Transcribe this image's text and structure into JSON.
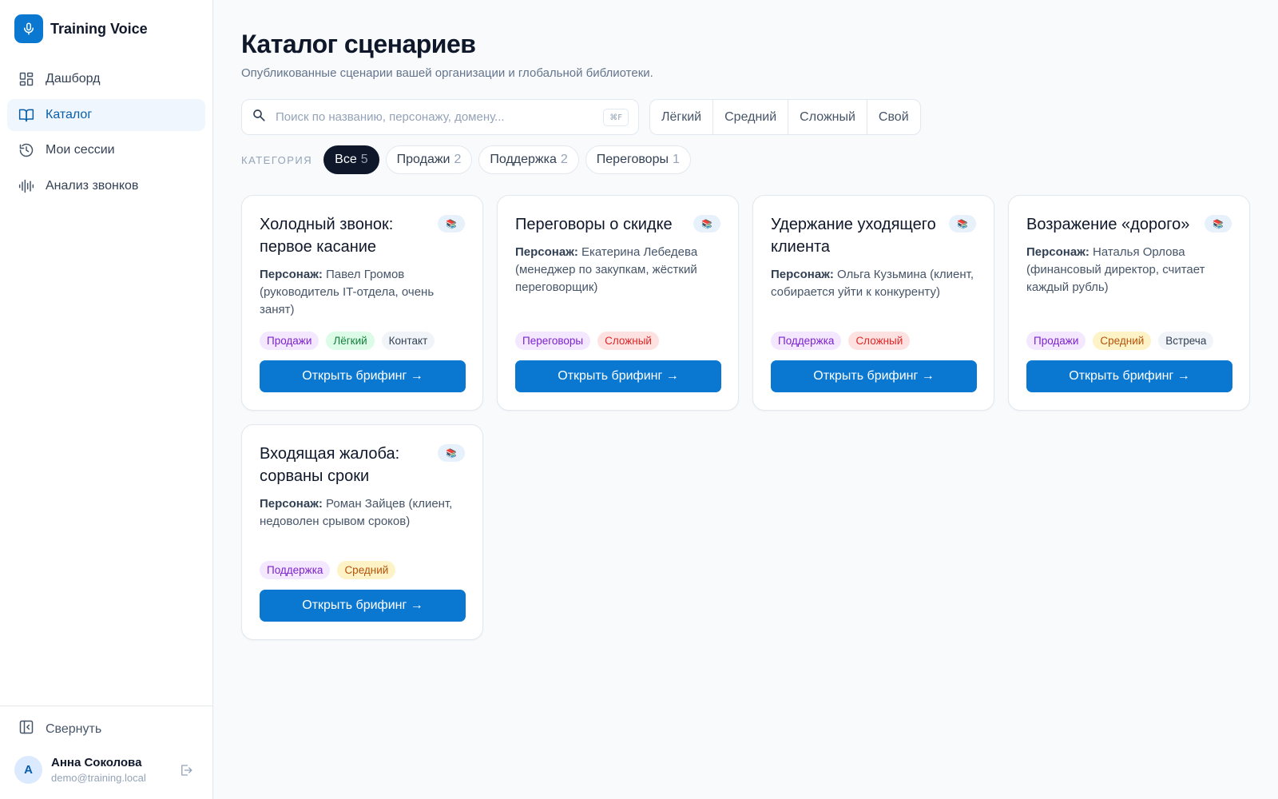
{
  "app": {
    "name": "Training Voice"
  },
  "sidebar": {
    "items": [
      {
        "label": "Дашборд",
        "icon": "dashboard-icon"
      },
      {
        "label": "Каталог",
        "icon": "book-icon",
        "active": true
      },
      {
        "label": "Мои сессии",
        "icon": "history-icon"
      },
      {
        "label": "Анализ звонков",
        "icon": "waveform-icon"
      }
    ],
    "collapse_label": "Свернуть",
    "user": {
      "initial": "A",
      "name": "Анна Соколова",
      "email": "demo@training.local"
    }
  },
  "page": {
    "title": "Каталог сценариев",
    "subtitle": "Опубликованные сценарии вашей организации и глобальной библиотеки."
  },
  "search": {
    "placeholder": "Поиск по названию, персонажу, домену...",
    "value": "",
    "shortcut": "⌘F"
  },
  "difficulty_filters": [
    "Лёгкий",
    "Средний",
    "Сложный",
    "Свой"
  ],
  "categories": {
    "label": "КАТЕГОРИЯ",
    "chips": [
      {
        "label": "Все",
        "count": "5",
        "active": true
      },
      {
        "label": "Продажи",
        "count": "2"
      },
      {
        "label": "Поддержка",
        "count": "2"
      },
      {
        "label": "Переговоры",
        "count": "1"
      }
    ]
  },
  "persona_label": "Персонаж:",
  "open_label": "Открыть брифинг →",
  "colors": {
    "accent": "#0a78d1",
    "active_chip": "#0f172a"
  },
  "scenarios": [
    {
      "title": "Холодный звонок: первое касание",
      "persona": "Павел Громов (руководитель IT-отдела, очень занят)",
      "tags": [
        {
          "text": "Продажи",
          "tone": "violet"
        },
        {
          "text": "Лёгкий",
          "tone": "green"
        },
        {
          "text": "Контакт",
          "tone": "gray"
        }
      ]
    },
    {
      "title": "Переговоры о скидке",
      "persona": "Екатерина Лебедева (менеджер по закупкам, жёсткий переговорщик)",
      "tags": [
        {
          "text": "Переговоры",
          "tone": "violet"
        },
        {
          "text": "Сложный",
          "tone": "red"
        }
      ]
    },
    {
      "title": "Удержание уходящего клиента",
      "persona": "Ольга Кузьмина (клиент, собирается уйти к конкуренту)",
      "tags": [
        {
          "text": "Поддержка",
          "tone": "violet"
        },
        {
          "text": "Сложный",
          "tone": "red"
        }
      ]
    },
    {
      "title": "Возражение «дорого»",
      "persona": "Наталья Орлова (финансовый директор, считает каждый рубль)",
      "tags": [
        {
          "text": "Продажи",
          "tone": "violet"
        },
        {
          "text": "Средний",
          "tone": "amber"
        },
        {
          "text": "Встреча",
          "tone": "gray"
        }
      ]
    },
    {
      "title": "Входящая жалоба: сорваны сроки",
      "persona": "Роман Зайцев (клиент, недоволен срывом сроков)",
      "tags": [
        {
          "text": "Поддержка",
          "tone": "violet"
        },
        {
          "text": "Средний",
          "tone": "amber"
        }
      ]
    }
  ]
}
